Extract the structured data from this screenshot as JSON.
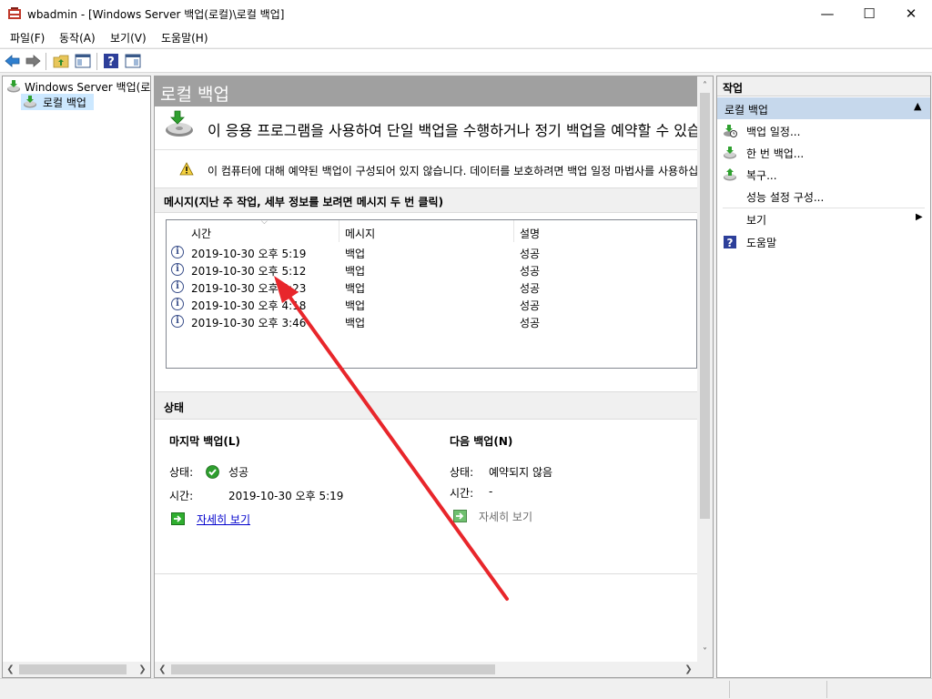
{
  "window": {
    "title": "wbadmin - [Windows Server 백업(로컬)\\로컬 백업]",
    "minimize": "—",
    "maximize": "☐",
    "close": "✕"
  },
  "menu": [
    "파일(F)",
    "동작(A)",
    "보기(V)",
    "도움말(H)"
  ],
  "tree": {
    "root": "Windows Server 백업(로컬)",
    "child": "로컬 백업"
  },
  "main": {
    "header": "로컬 백업",
    "intro": "이 응용 프로그램을 사용하여 단일 백업을 수행하거나 정기 백업을 예약할 수 있습니다.",
    "warning": "이 컴퓨터에 대해 예약된 백업이 구성되어 있지 않습니다. 데이터를 보호하려면 백업 일정 마법사를 사용하십시오.",
    "messages_title": "메시지(지난 주 작업, 세부 정보를 보려면 메시지 두 번 클릭)",
    "columns": [
      "시간",
      "메시지",
      "설명"
    ],
    "rows": [
      {
        "time": "2019-10-30 오후 5:19",
        "message": "백업",
        "desc": "성공"
      },
      {
        "time": "2019-10-30 오후 5:12",
        "message": "백업",
        "desc": "성공"
      },
      {
        "time": "2019-10-30 오후 4:23",
        "message": "백업",
        "desc": "성공"
      },
      {
        "time": "2019-10-30 오후 4:18",
        "message": "백업",
        "desc": "성공"
      },
      {
        "time": "2019-10-30 오후 3:46",
        "message": "백업",
        "desc": "성공"
      }
    ],
    "status_title": "상태",
    "last_backup": {
      "title": "마지막 백업(L)",
      "status_label": "상태:",
      "status_value": "성공",
      "time_label": "시간:",
      "time_value": "2019-10-30 오후 5:19",
      "details_link": "자세히 보기"
    },
    "next_backup": {
      "title": "다음 백업(N)",
      "status_label": "상태:",
      "status_value": "예약되지 않음",
      "time_label": "시간:",
      "time_value": "-",
      "details_link": "자세히 보기"
    }
  },
  "actions": {
    "title": "작업",
    "section": "로컬 백업",
    "items": [
      {
        "label": "백업 일정...",
        "icon": "backup-schedule-icon"
      },
      {
        "label": "한 번 백업...",
        "icon": "backup-once-icon"
      },
      {
        "label": "복구...",
        "icon": "recover-icon"
      },
      {
        "label": "성능 설정 구성...",
        "icon": ""
      },
      {
        "label": "보기",
        "icon": ""
      },
      {
        "label": "도움말",
        "icon": "help-icon"
      }
    ]
  },
  "colors": {
    "header_bg": "#a0a0a0",
    "section_bg": "#f0f0f0",
    "action_section_bg": "#c6d8ec",
    "link": "#0000cc",
    "annotation_arrow": "#e8262b"
  }
}
